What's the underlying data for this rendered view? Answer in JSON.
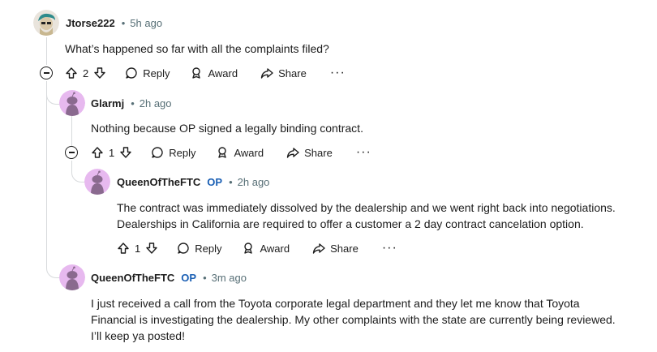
{
  "comments": [
    {
      "author": "Jtorse222",
      "is_op": false,
      "time": "5h ago",
      "body": [
        "What’s happened so far with all the complaints filed?"
      ],
      "votes": "2"
    },
    {
      "author": "Glarmj",
      "is_op": false,
      "time": "2h ago",
      "body": [
        "Nothing because OP signed a legally binding contract."
      ],
      "votes": "1"
    },
    {
      "author": "QueenOfTheFTC",
      "is_op": true,
      "op_label": "OP",
      "time": "2h ago",
      "body": [
        "The contract was immediately dissolved by the dealership and we went right back into negotiations.",
        "Dealerships in California are required to offer a customer a 2 day contract cancelation option."
      ],
      "votes": "1"
    },
    {
      "author": "QueenOfTheFTC",
      "is_op": true,
      "op_label": "OP",
      "time": "3m ago",
      "body": [
        "I just received a call from the Toyota corporate legal department and they let me know that Toyota",
        "Financial is investigating the dealership. My other complaints with the state are currently being reviewed.",
        "I’ll keep ya posted!"
      ]
    }
  ],
  "actions": {
    "reply": "Reply",
    "award": "Award",
    "share": "Share",
    "more": "···"
  },
  "meta": {
    "separator": "•"
  },
  "colors": {
    "thread_line": "#d7dadc",
    "op_label": "#1a5fb4",
    "avatar_bg": "#e7b9ef"
  }
}
